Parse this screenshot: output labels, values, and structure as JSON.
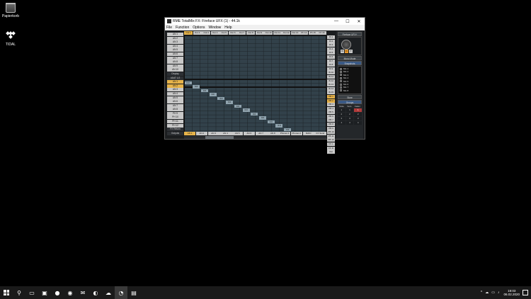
{
  "desktop": {
    "icons": [
      {
        "label": "Papierkorb",
        "icon": "recycle-bin-icon"
      },
      {
        "label": "TIDAL",
        "icon": "tidal-icon"
      }
    ]
  },
  "window": {
    "title": "RME TotalMix FX: Fireface UFX (1) - 44.1k",
    "controls": [
      "—",
      "☐",
      "✕"
    ],
    "menu": [
      "File",
      "Function",
      "Options",
      "Window",
      "Help"
    ]
  },
  "matrix": {
    "col_headers": [
      "Out 1",
      "Out 2",
      "Out 3",
      "Out 4",
      "Out 5",
      "Out 6",
      "Out 7",
      "Out 8",
      "Out 9",
      "Out 10",
      "Out 11",
      "Out 12",
      "Out 13",
      "Ph 14",
      "Ph 15",
      "FX 16"
    ],
    "active_col": 0,
    "row_labels": [
      "AN 1",
      "AN 2",
      "AN 3",
      "AN 4",
      "AN 5",
      "AN 6",
      "AN 7",
      "AN 8",
      "AN 9",
      "AN 10",
      "Display",
      "ADAT 1/2",
      "AN 1",
      "AN 2",
      "AN 3",
      "AN 4",
      "AN 5",
      "AN 6",
      "AN 7",
      "AN 8",
      "PH 9",
      "PH 10",
      "PH 11",
      "PH 12",
      "FX Return",
      "Outputs"
    ],
    "active_rows": [
      12,
      13
    ],
    "dark_rows": [
      10,
      11,
      24,
      25
    ],
    "right_labels": [
      "IN 1",
      "IN 2",
      "IN 3",
      "IN 4",
      "IN 5",
      "IN 6",
      "IN 7",
      "IN 8",
      "IN 9",
      "IN 10",
      "IN 11",
      "IN 12",
      "IN 13",
      "IN 14",
      "IN 15",
      "PB 1",
      "PB 2",
      "PB 3",
      "PB 4",
      "PB 5",
      "PB 6",
      "PB 7",
      "PB 8",
      "PB 9",
      "PB 10",
      "PB 11",
      "PB 12",
      "FX L",
      "FX R",
      "Out"
    ],
    "active_right": [
      15,
      16
    ],
    "cell_value": "0.0",
    "bottom_tabs": [
      "AN 1",
      "AN 2",
      "AN 3",
      "AN 4",
      "AN 5",
      "AN 6",
      "AN 7",
      "AN 8",
      "Phones 1",
      "Phones 2",
      "MAIN",
      "FX Send"
    ],
    "active_tab": 0
  },
  "panel": {
    "device_button": "Fireface UFX+",
    "mini_buttons": [
      "M",
      "D",
      "T"
    ],
    "mono_button": "Mono Mode",
    "snapshots_header": "Snapshots",
    "snapshots": [
      "Mix 1",
      "Mix 2",
      "Mix 3",
      "Mix 4",
      "Mix 5",
      "Mix 6",
      "Mix 7",
      "Mix 8"
    ],
    "store_button": "Store",
    "groups_header": "Groups",
    "group_cols": [
      "Mute",
      "Solo",
      "Fader"
    ],
    "group_cells": [
      "1",
      "1",
      "1",
      "2",
      "2",
      "2",
      "3",
      "3",
      "3",
      "4",
      "4",
      "4"
    ],
    "group_red": [
      2
    ]
  },
  "taskbar": {
    "apps": [
      {
        "icon": "start-icon",
        "active": false
      },
      {
        "icon": "search-icon",
        "glyph": "⚲",
        "active": false
      },
      {
        "icon": "task-view-icon",
        "glyph": "▭",
        "active": false
      },
      {
        "icon": "store-icon",
        "glyph": "▣",
        "active": false
      },
      {
        "icon": "app-icon",
        "glyph": "●",
        "active": false
      },
      {
        "icon": "chrome-icon",
        "glyph": "◉",
        "active": false
      },
      {
        "icon": "mail-icon",
        "glyph": "✉",
        "active": false
      },
      {
        "icon": "browser-icon",
        "glyph": "◐",
        "active": false
      },
      {
        "icon": "cloud-icon",
        "glyph": "☁",
        "active": false
      },
      {
        "icon": "totalmix-icon",
        "glyph": "◔",
        "active": true
      },
      {
        "icon": "mixer-icon",
        "glyph": "▤",
        "active": false
      }
    ],
    "tray": [
      "^",
      "☁",
      "▭",
      "♪"
    ],
    "time": "19:03",
    "date": "06.02.2020"
  }
}
